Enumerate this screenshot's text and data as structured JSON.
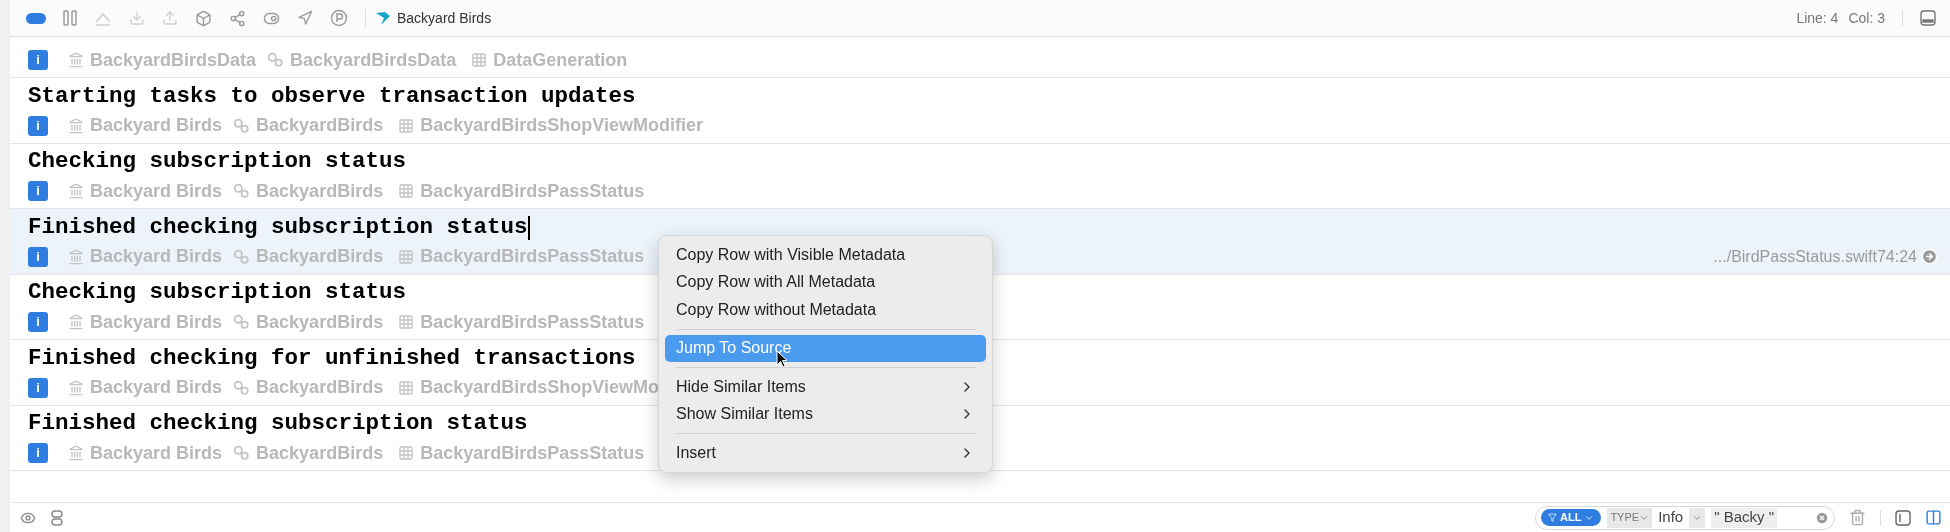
{
  "toolbar": {
    "scheme": "Backyard Birds",
    "line": "Line: 4",
    "col": "Col: 3"
  },
  "rows": [
    {
      "badge": "i",
      "library": "BackyardBirdsData",
      "process": "BackyardBirdsData",
      "category": "DataGeneration",
      "selected": false
    },
    {
      "message": "Starting tasks to observe transaction updates",
      "badge": "i",
      "library": "Backyard Birds",
      "process": "BackyardBirds",
      "category": "BackyardBirdsShopViewModifier",
      "selected": false
    },
    {
      "message": "Checking subscription status",
      "badge": "i",
      "library": "Backyard Birds",
      "process": "BackyardBirds",
      "category": "BackyardBirdsPassStatus",
      "selected": false
    },
    {
      "message": "Finished checking subscription status",
      "badge": "i",
      "library": "Backyard Birds",
      "process": "BackyardBirds",
      "category": "BackyardBirdsPassStatus",
      "selected": true,
      "source": ".../BirdPassStatus.swift74:24"
    },
    {
      "message": "Checking subscription status",
      "badge": "i",
      "library": "Backyard Birds",
      "process": "BackyardBirds",
      "category": "BackyardBirdsPassStatus",
      "selected": false
    },
    {
      "message": "Finished checking for unfinished transactions",
      "badge": "i",
      "library": "Backyard Birds",
      "process": "BackyardBirds",
      "category": "BackyardBirdsShopViewMo",
      "selected": false
    },
    {
      "message": "Finished checking subscription status",
      "badge": "i",
      "library": "Backyard Birds",
      "process": "BackyardBirds",
      "category": "BackyardBirdsPassStatus",
      "selected": false
    }
  ],
  "context_menu": [
    {
      "kind": "item",
      "label": "Copy Row with Visible Metadata",
      "selected": false
    },
    {
      "kind": "item",
      "label": "Copy Row with All Metadata",
      "selected": false
    },
    {
      "kind": "item",
      "label": "Copy Row without Metadata",
      "selected": false
    },
    {
      "kind": "separator"
    },
    {
      "kind": "item",
      "label": "Jump To Source",
      "selected": true
    },
    {
      "kind": "separator"
    },
    {
      "kind": "submenu",
      "label": "Hide Similar Items",
      "selected": false
    },
    {
      "kind": "submenu",
      "label": "Show Similar Items",
      "selected": false
    },
    {
      "kind": "separator"
    },
    {
      "kind": "submenu",
      "label": "Insert",
      "selected": false
    }
  ],
  "filter": {
    "scope": "ALL",
    "token_type": "TYPE",
    "token_value": "Info",
    "query": "\" Backy \""
  }
}
